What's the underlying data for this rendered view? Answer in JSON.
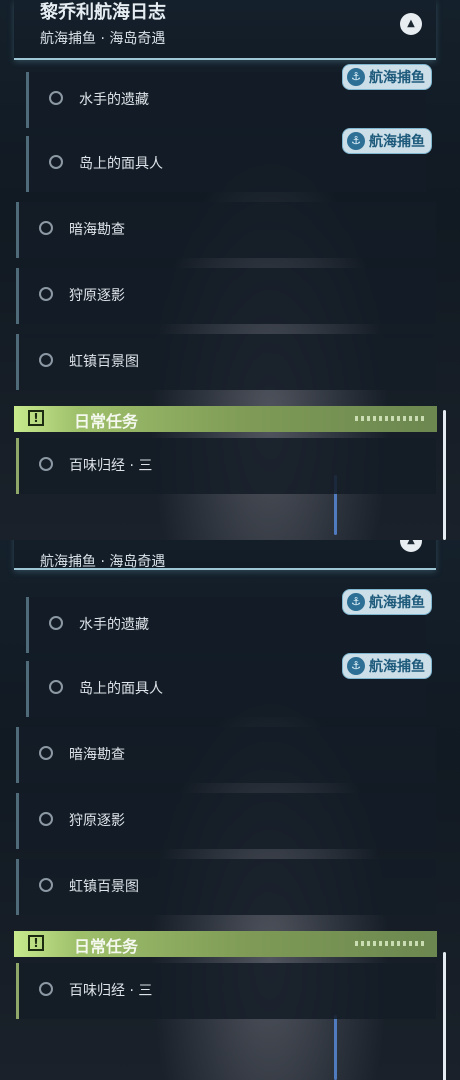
{
  "panels": {
    "top": {
      "header": {
        "title": "黎乔利航海日志",
        "subtitle": "航海捕鱼 · 海岛奇遇",
        "collapse_icon": "chevron-up-icon"
      },
      "quests": [
        {
          "label": "水手的遗藏",
          "badge": "航海捕鱼"
        },
        {
          "label": "岛上的面具人",
          "badge": "航海捕鱼"
        },
        {
          "label": "暗海勘查"
        },
        {
          "label": "狩原逐影"
        },
        {
          "label": "虹镇百景图"
        }
      ],
      "daily": {
        "section_title": "日常任务",
        "icon": "alert-icon",
        "quest": "百味归经 · 三"
      }
    },
    "bottom": {
      "header": {
        "subtitle": "航海捕鱼 · 海岛奇遇",
        "collapse_icon": "chevron-up-icon"
      },
      "quests": [
        {
          "label": "水手的遗藏",
          "badge": "航海捕鱼"
        },
        {
          "label": "岛上的面具人",
          "badge": "航海捕鱼"
        },
        {
          "label": "暗海勘查"
        },
        {
          "label": "狩原逐影"
        },
        {
          "label": "虹镇百景图"
        }
      ],
      "daily": {
        "section_title": "日常任务",
        "icon": "alert-icon",
        "quest": "百味归经 · 三"
      }
    }
  },
  "colors": {
    "accent_green": "#9fc06b",
    "badge_blue": "#1e5a7b",
    "header_line": "#9fc6d4"
  }
}
